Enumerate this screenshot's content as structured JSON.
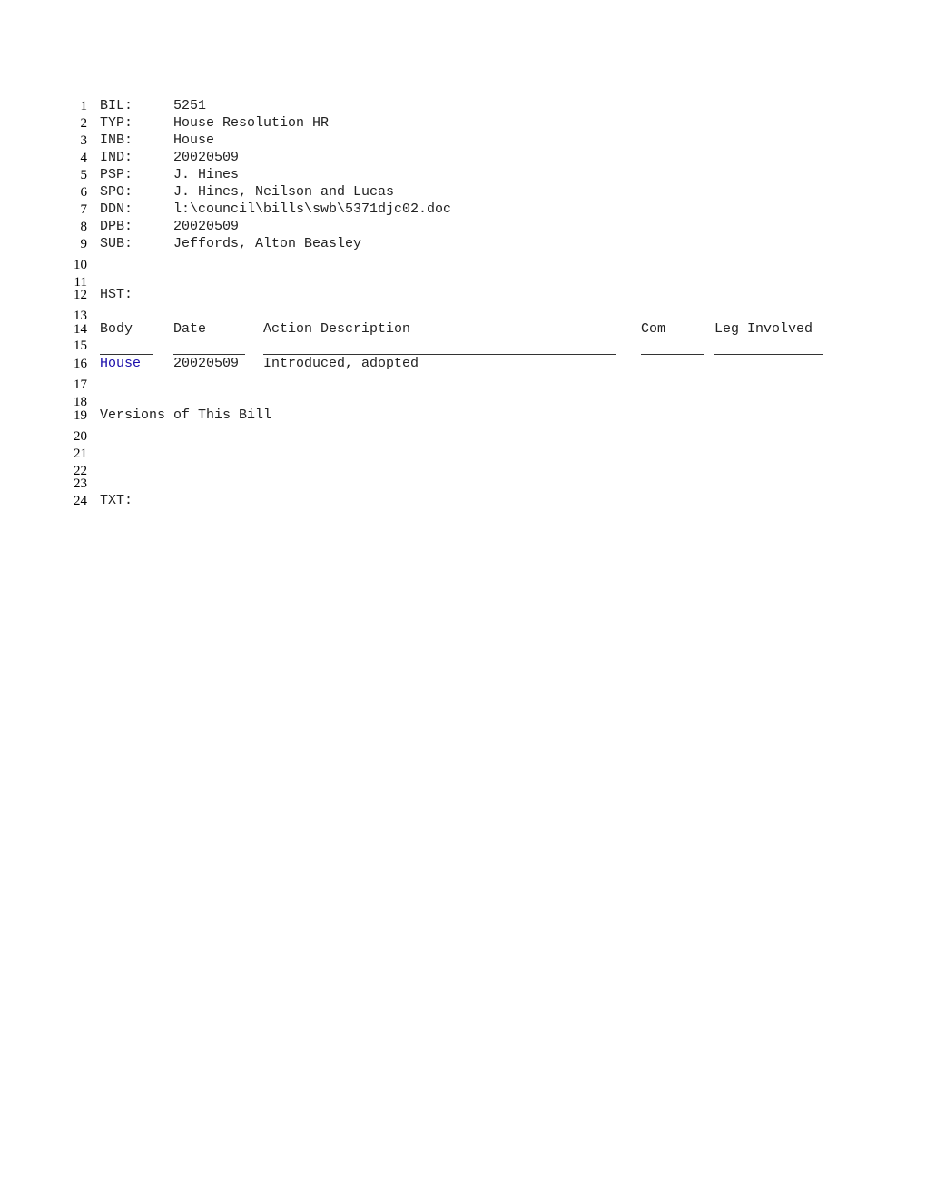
{
  "fields": [
    {
      "num": "1",
      "label": "BIL:",
      "value": "5251"
    },
    {
      "num": "2",
      "label": "TYP:",
      "value": "House Resolution HR"
    },
    {
      "num": "3",
      "label": "INB:",
      "value": "House"
    },
    {
      "num": "4",
      "label": "IND:",
      "value": "20020509"
    },
    {
      "num": "5",
      "label": "PSP:",
      "value": "J. Hines"
    },
    {
      "num": "6",
      "label": "SPO:",
      "value": "J. Hines, Neilson and Lucas"
    },
    {
      "num": "7",
      "label": "DDN:",
      "value": "l:\\council\\bills\\swb\\5371djc02.doc"
    },
    {
      "num": "8",
      "label": "DPB:",
      "value": "20020509"
    },
    {
      "num": "9",
      "label": "SUB:",
      "value": "Jeffords, Alton Beasley"
    }
  ],
  "empty_lines": [
    "10",
    "11",
    "13",
    "15",
    "17",
    "18",
    "20",
    "21",
    "22",
    "23"
  ],
  "history": {
    "num": "12",
    "label": "HST:",
    "header_num": "14",
    "columns": [
      "Body",
      "Date",
      "Action Description",
      "Com",
      "Leg Involved"
    ],
    "rows": [
      {
        "num": "16",
        "body": "House",
        "date": "20020509",
        "action": "Introduced, adopted",
        "com": "",
        "leg": ""
      }
    ]
  },
  "versions": {
    "num": "19",
    "label": "Versions of This Bill"
  },
  "text": {
    "num": "24",
    "label": "TXT:"
  }
}
